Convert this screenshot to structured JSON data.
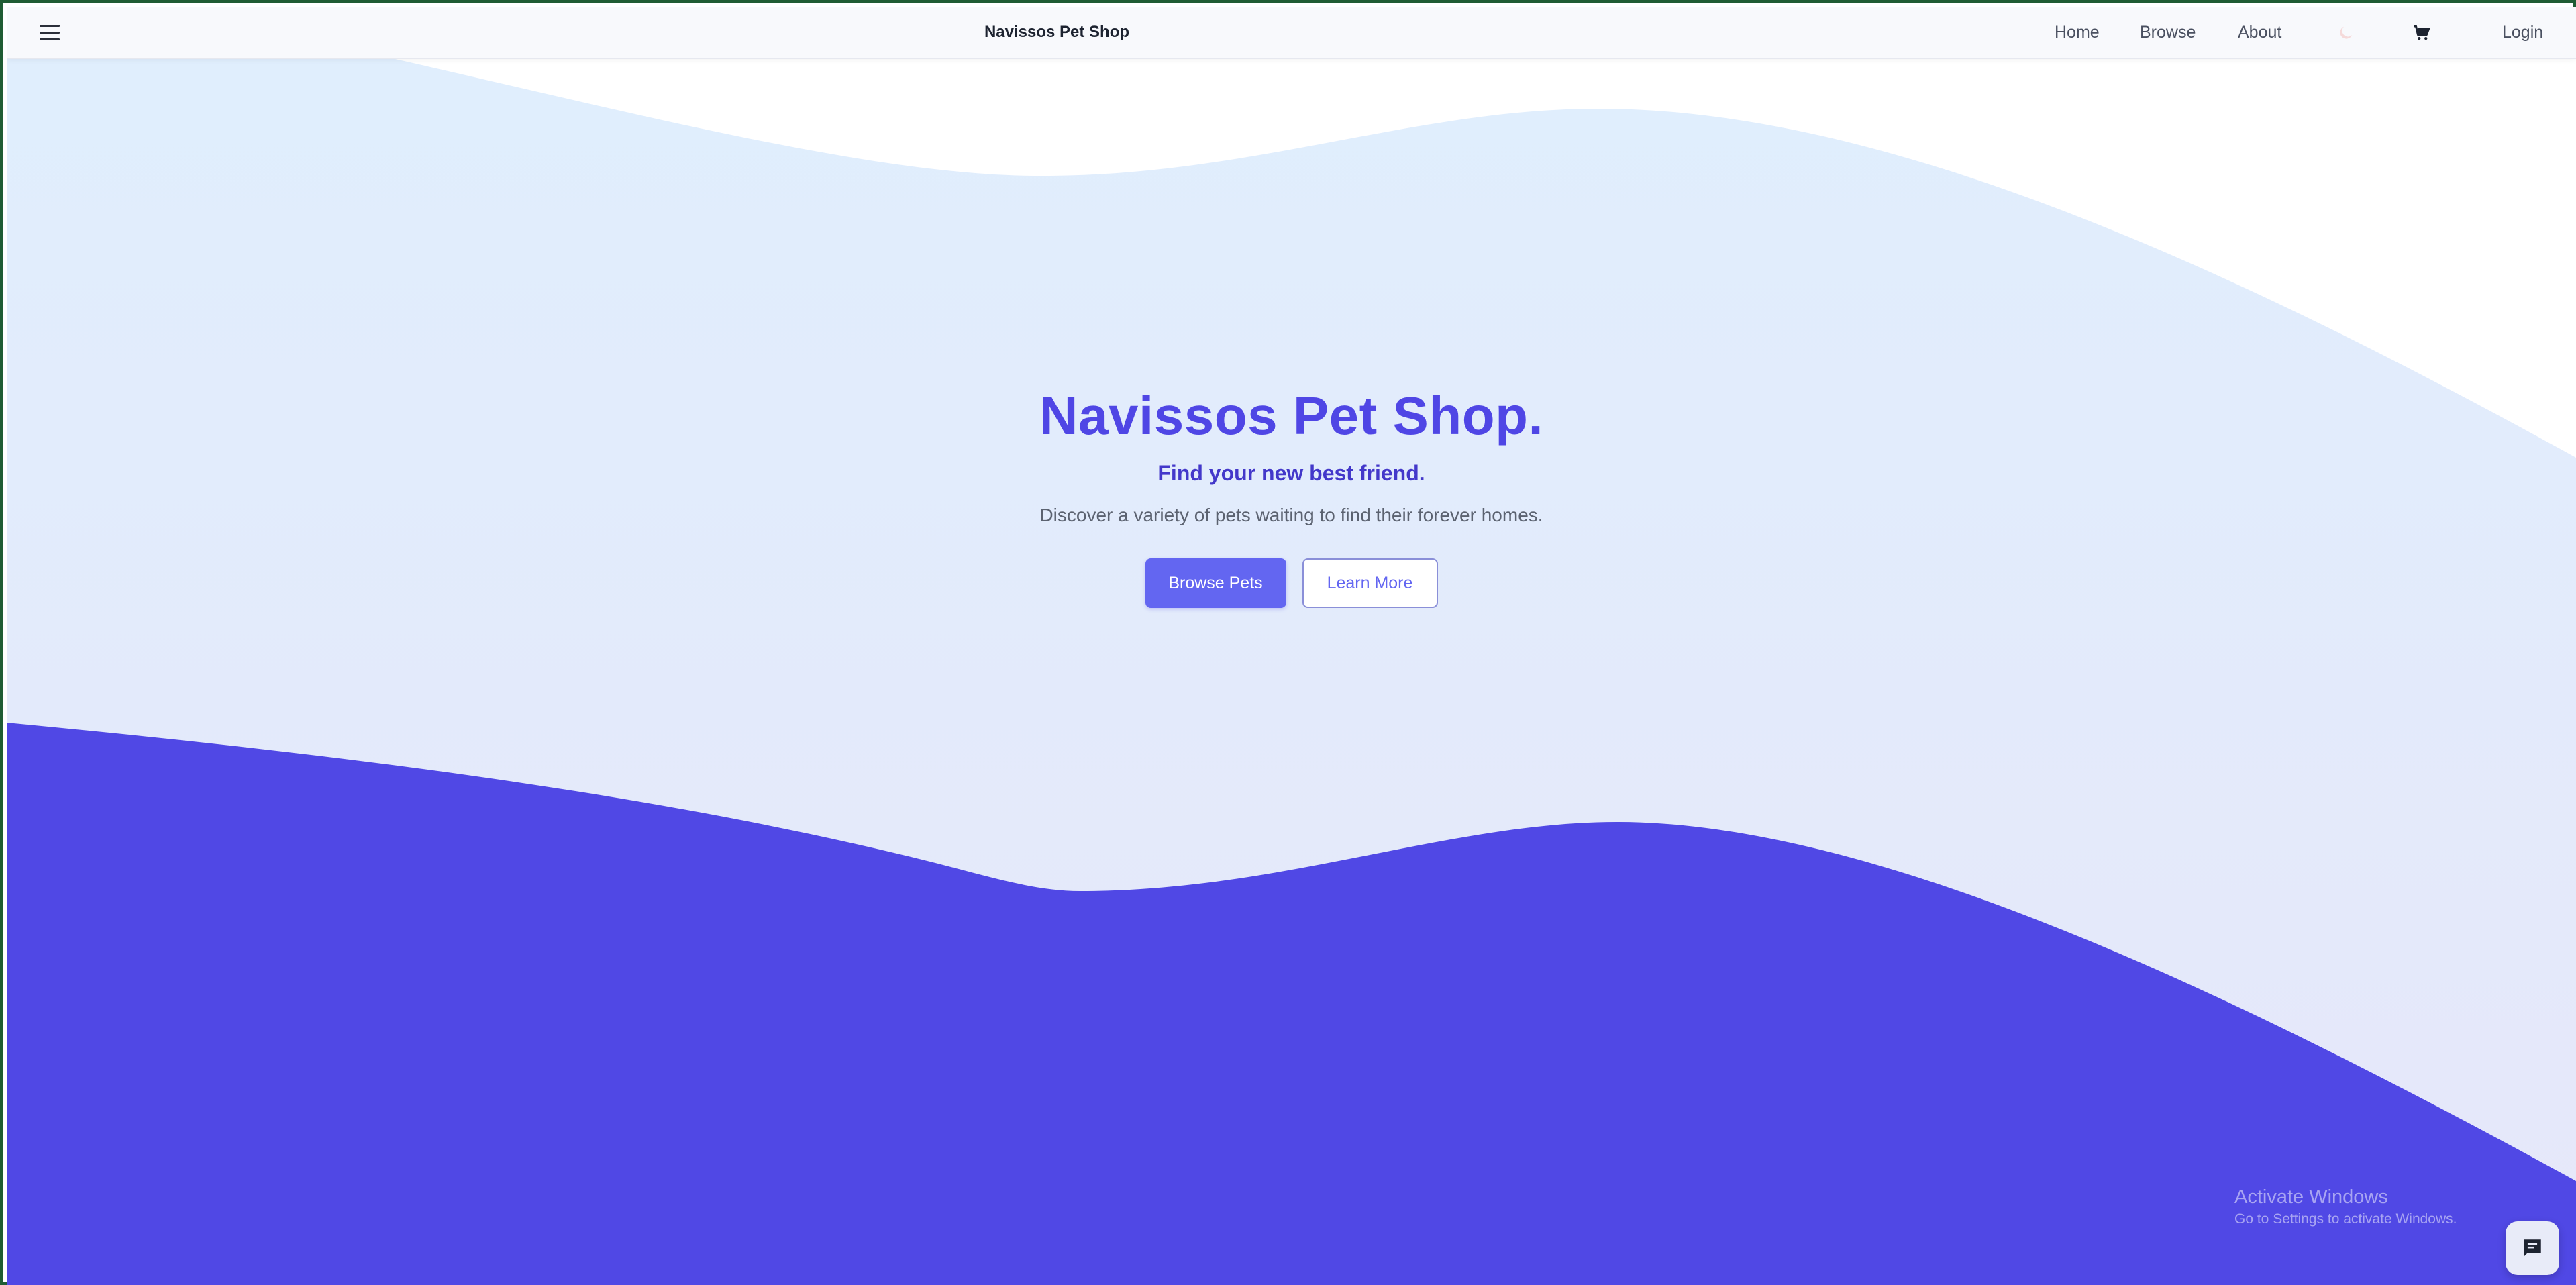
{
  "navbar": {
    "brand": "Navissos Pet Shop",
    "links": [
      "Home",
      "Browse",
      "About"
    ],
    "login": "Login",
    "menu_icon": "hamburger-menu-icon",
    "theme_icon": "moon-icon",
    "cart_icon": "shopping-cart-icon"
  },
  "hero": {
    "title": "Navissos Pet Shop.",
    "subtitle": "Find your new best friend.",
    "description": "Discover a variety of pets waiting to find their forever homes.",
    "primary_button": "Browse Pets",
    "secondary_button": "Learn More"
  },
  "watermark": {
    "title": "Activate Windows",
    "subtitle": "Go to Settings to activate Windows."
  },
  "chat": {
    "icon": "chat-bubble-icon"
  },
  "colors": {
    "accent": "#4f46e5",
    "primary_button": "#6366f1",
    "wave_light": "#e0eefd",
    "wave_dark": "#5048e5"
  }
}
